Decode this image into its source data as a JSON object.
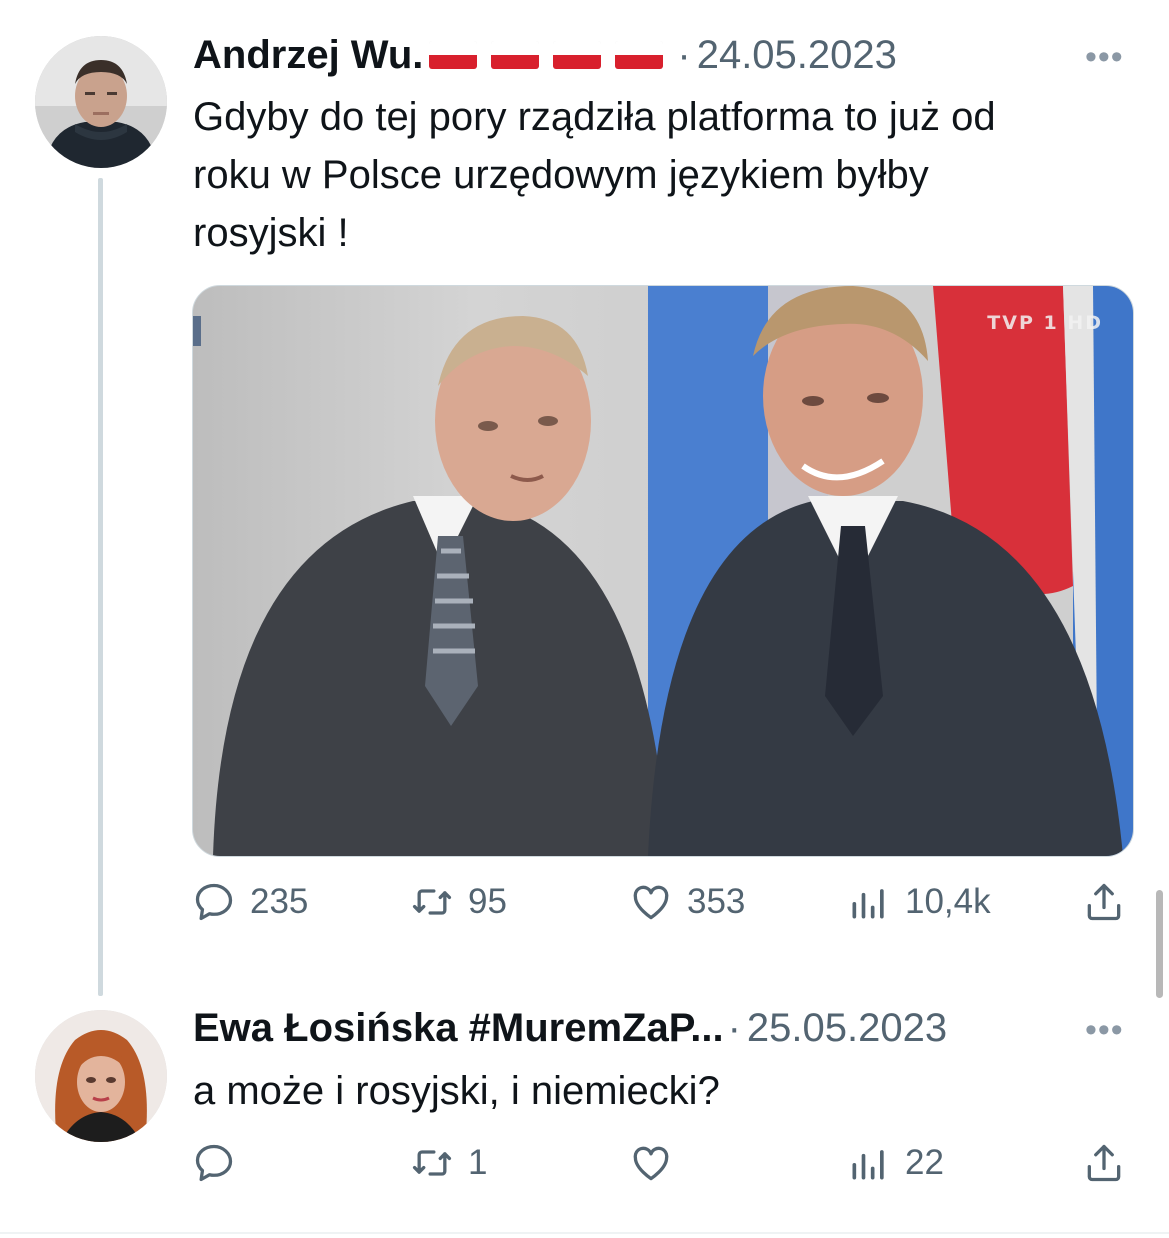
{
  "tweets": [
    {
      "author": "Andrzej Wu.",
      "separator": "·",
      "date": "24.05.2023",
      "more": "•••",
      "text": "Gdyby do tej pory rządziła platforma to już od\nroku w Polsce urzędowym językiem byłby\nrosyjski !",
      "media_logo": "TVP 1 HD",
      "stats": {
        "replies": "235",
        "retweets": "95",
        "likes": "353",
        "views": "10,4k"
      }
    },
    {
      "author": "Ewa Łosińska #MuremZaP...",
      "separator": "·",
      "date": "25.05.2023",
      "more": "•••",
      "text": "a może i rosyjski, i niemiecki?",
      "stats": {
        "replies": "",
        "retweets": "1",
        "likes": "",
        "views": "22"
      }
    }
  ],
  "icons": {
    "reply": "reply-icon",
    "retweet": "retweet-icon",
    "like": "heart-icon",
    "views": "views-icon",
    "share": "share-icon"
  },
  "colors": {
    "text": "#0f1419",
    "muted": "#536471",
    "border": "#cfd9de",
    "flag_red": "#d8202d"
  }
}
